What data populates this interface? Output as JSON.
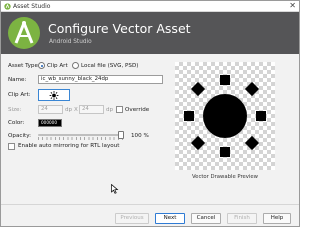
{
  "window": {
    "title": "Asset Studio",
    "close_glyph": "✕",
    "app_icon": "asset-studio-icon"
  },
  "banner": {
    "heading": "Configure Vector Asset",
    "subheading": "Android Studio",
    "logo_icon": "android-studio-logo"
  },
  "form": {
    "asset_type": {
      "label": "Asset Type:",
      "options": [
        {
          "label": "Clip Art",
          "selected": true
        },
        {
          "label": "Local file (SVG, PSD)",
          "selected": false
        }
      ]
    },
    "name": {
      "label": "Name:",
      "value": "ic_wb_sunny_black_24dp"
    },
    "clip_art": {
      "label": "Clip Art:",
      "icon": "sunny-icon"
    },
    "size": {
      "label": "Size:",
      "width": "24",
      "width_unit": "dp",
      "separator": "X",
      "height": "24",
      "height_unit": "dp",
      "override_label": "Override",
      "override_checked": false
    },
    "color": {
      "label": "Color:",
      "value": "000000",
      "hex": "#000000"
    },
    "opacity": {
      "label": "Opacity:",
      "value": "100 %",
      "percent": 100
    },
    "auto_mirror": {
      "label": "Enable auto mirroring for RTL layout",
      "checked": false
    }
  },
  "preview": {
    "caption": "Vector Drawable Preview",
    "icon": "sunny-icon"
  },
  "footer": {
    "buttons": [
      {
        "label": "Previous",
        "enabled": false
      },
      {
        "label": "Next",
        "enabled": true,
        "primary": true
      },
      {
        "label": "Cancel",
        "enabled": true
      },
      {
        "label": "Finish",
        "enabled": false
      },
      {
        "label": "Help",
        "enabled": true
      }
    ]
  },
  "colors": {
    "banner_bg": "#555557",
    "accent": "#2f7bd4",
    "android_green": "#7cb342"
  }
}
